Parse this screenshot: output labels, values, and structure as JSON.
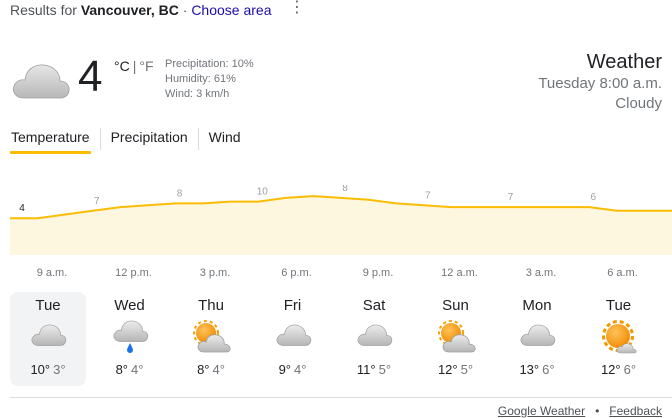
{
  "header": {
    "results_prefix": "Results for",
    "location": "Vancouver, BC",
    "separator": "·",
    "choose_area": "Choose area"
  },
  "current": {
    "icon": "cloud-icon",
    "temperature": "4",
    "unit_c": "°C",
    "unit_sep": "|",
    "unit_f": "°F",
    "precipitation": "Precipitation: 10%",
    "humidity": "Humidity: 61%",
    "wind": "Wind: 3 km/h"
  },
  "weather": {
    "title": "Weather",
    "datetime": "Tuesday 8:00 a.m.",
    "condition": "Cloudy"
  },
  "tabs": [
    "Temperature",
    "Precipitation",
    "Wind"
  ],
  "active_tab": "Temperature",
  "chart_data": {
    "type": "area",
    "x": [
      "8 a.m.",
      "9 a.m.",
      "10 a.m.",
      "11 a.m.",
      "12 p.m.",
      "1 p.m.",
      "2 p.m.",
      "3 p.m.",
      "4 p.m.",
      "5 p.m.",
      "6 p.m.",
      "7 p.m.",
      "8 p.m.",
      "9 p.m.",
      "10 p.m.",
      "11 p.m.",
      "12 a.m.",
      "1 a.m.",
      "2 a.m.",
      "3 a.m.",
      "4 a.m.",
      "5 a.m.",
      "6 a.m.",
      "7 a.m.",
      "8 a.m."
    ],
    "values": [
      4,
      4,
      5,
      6,
      7,
      7.5,
      8,
      8,
      8.5,
      8.5,
      9.5,
      10,
      9.5,
      9,
      8,
      7.5,
      7,
      7,
      7,
      7,
      7,
      7,
      6,
      6,
      6
    ],
    "point_labels": [
      {
        "index": 0,
        "value": "4"
      },
      {
        "index": 3,
        "value": "7"
      },
      {
        "index": 6,
        "value": "8"
      },
      {
        "index": 9,
        "value": "10"
      },
      {
        "index": 12,
        "value": "8"
      },
      {
        "index": 15,
        "value": "7"
      },
      {
        "index": 18,
        "value": "7"
      },
      {
        "index": 21,
        "value": "6"
      }
    ],
    "time_labels": [
      "9 a.m.",
      "12 p.m.",
      "3 p.m.",
      "6 p.m.",
      "9 p.m.",
      "12 a.m.",
      "3 a.m.",
      "6 a.m."
    ],
    "line_color": "#fbbc04",
    "fill_color": "#fef7e0",
    "ylim": [
      -6,
      13
    ]
  },
  "forecast": [
    {
      "day": "Tue",
      "icon": "cloud-icon",
      "high": "10°",
      "low": "3°",
      "selected": true
    },
    {
      "day": "Wed",
      "icon": "rain-icon",
      "high": "8°",
      "low": "4°"
    },
    {
      "day": "Thu",
      "icon": "partly-cloudy-icon",
      "high": "8°",
      "low": "4°"
    },
    {
      "day": "Fri",
      "icon": "cloud-icon",
      "high": "9°",
      "low": "4°"
    },
    {
      "day": "Sat",
      "icon": "cloud-icon",
      "high": "11°",
      "low": "5°"
    },
    {
      "day": "Sun",
      "icon": "partly-cloudy-icon",
      "high": "12°",
      "low": "5°"
    },
    {
      "day": "Mon",
      "icon": "cloud-icon",
      "high": "13°",
      "low": "6°"
    },
    {
      "day": "Tue",
      "icon": "mostly-sunny-icon",
      "high": "12°",
      "low": "6°"
    }
  ],
  "footer": {
    "source_link": "Google Weather",
    "bullet": "•",
    "feedback_link": "Feedback"
  },
  "colors": {
    "accent": "#fbbc04",
    "link": "#1a0dab",
    "rain_drop": "#1a73e8",
    "sun": "#f29900"
  }
}
